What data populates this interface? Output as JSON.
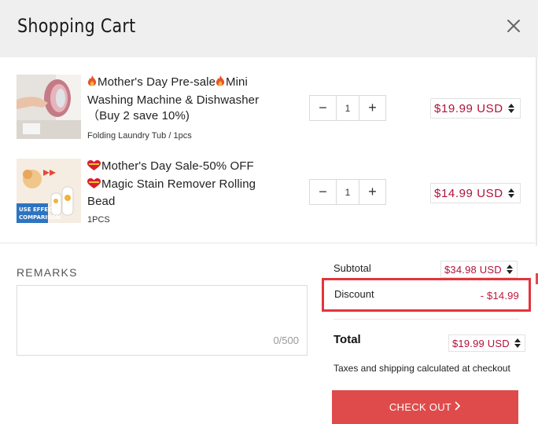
{
  "header": {
    "title": "Shopping Cart",
    "close_icon": "close-icon"
  },
  "items": [
    {
      "name_1": "Mother's Day Pre-sale",
      "name_2": "Mini Washing Machine & Dishwasher（Buy 2 save 10%)",
      "variant": "Folding Laundry Tub / 1pcs",
      "quantity": "1",
      "minus": "−",
      "plus": "+",
      "price": "$19.99 USD"
    },
    {
      "name_1": "Mother's Day Sale-50% OFF",
      "name_2": "Magic Stain Remover Rolling Bead",
      "variant": "1PCS",
      "quantity": "1",
      "minus": "−",
      "plus": "+",
      "price": "$14.99 USD",
      "thumb_text": "USE EFFECT\nCOMPARISON"
    }
  ],
  "remarks": {
    "label": "REMARKS",
    "counter": "0/500"
  },
  "summary": {
    "subtotal_label": "Subtotal",
    "subtotal_value": "$34.98 USD",
    "discount_label": "Discount",
    "discount_value": "- $14.99",
    "total_label": "Total",
    "total_value": "$19.99 USD",
    "note": "Taxes and shipping calculated at checkout"
  },
  "checkout": {
    "label": "CHECK OUT"
  },
  "colors": {
    "accent": "#df4b4b",
    "price": "#b0123a",
    "highlight": "#e3343c",
    "header_bg": "#efefef"
  }
}
